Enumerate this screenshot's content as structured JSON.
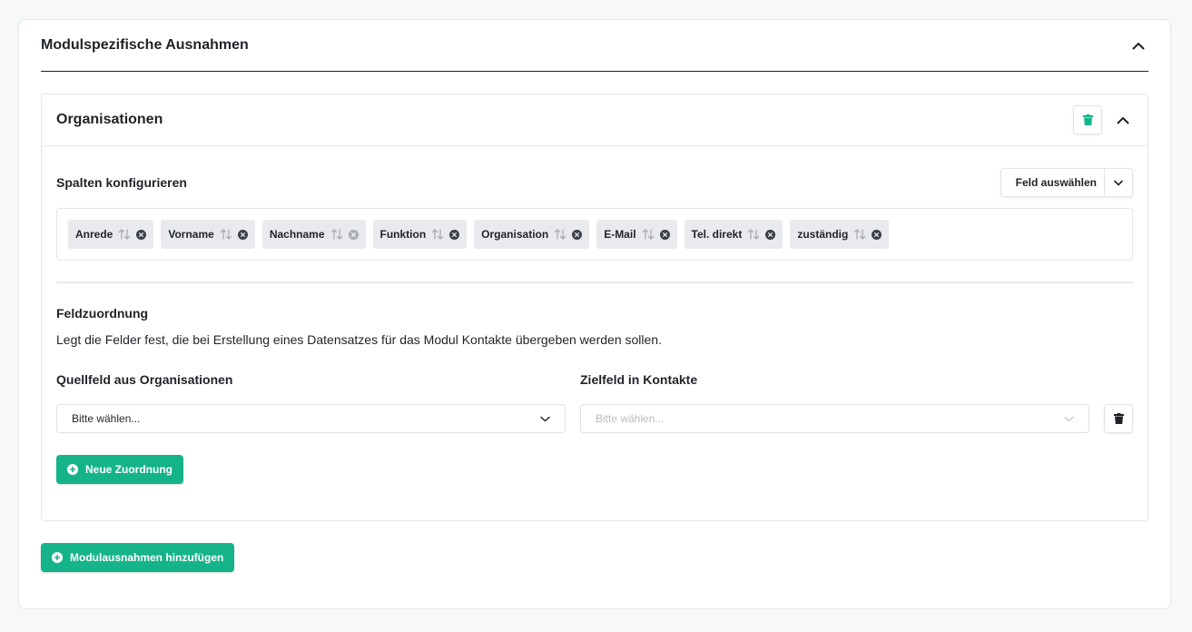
{
  "section": {
    "title": "Modulspezifische Ausnahmen"
  },
  "module": {
    "title": "Organisationen",
    "columns_label": "Spalten konfigurieren",
    "field_select_label": "Feld auswählen",
    "tags": [
      {
        "label": "Anrede",
        "removable": true
      },
      {
        "label": "Vorname",
        "removable": true
      },
      {
        "label": "Nachname",
        "removable": false
      },
      {
        "label": "Funktion",
        "removable": true
      },
      {
        "label": "Organisation",
        "removable": true
      },
      {
        "label": "E-Mail",
        "removable": true
      },
      {
        "label": "Tel. direkt",
        "removable": true
      },
      {
        "label": "zuständig",
        "removable": true
      }
    ],
    "mapping": {
      "title": "Feldzuordnung",
      "description": "Legt die Felder fest, die bei Erstellung eines Datensatzes für das Modul Kontakte übergeben werden sollen.",
      "source_label": "Quellfeld aus Organisationen",
      "target_label": "Zielfeld in Kontakte",
      "source_value": "Bitte wählen...",
      "target_placeholder": "Bitte wählen...",
      "new_mapping_label": "Neue Zuordnung"
    }
  },
  "add_module_label": "Modulausnahmen hinzufügen",
  "colors": {
    "accent": "#15b38a",
    "tag_bg": "#e9eaed",
    "text": "#1f2328"
  }
}
